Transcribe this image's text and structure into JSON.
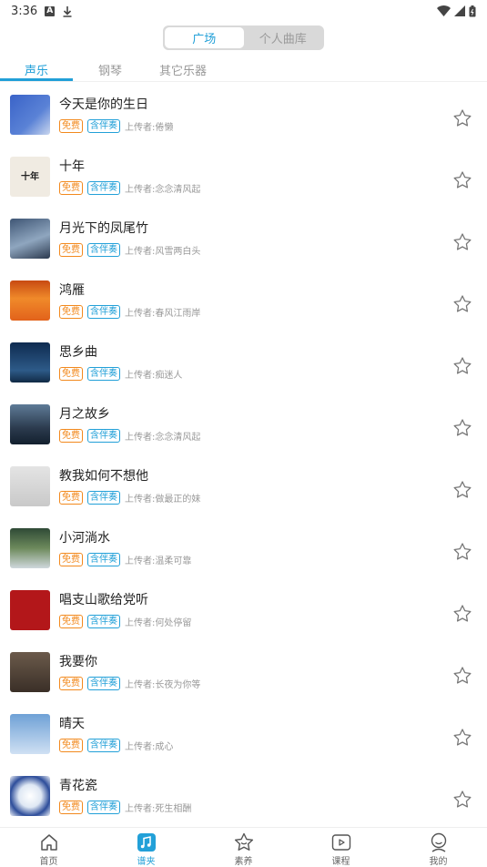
{
  "status_bar": {
    "time": "3:36",
    "icons": [
      "a-icon",
      "download-icon",
      "wifi-icon",
      "signal-icon",
      "battery-icon"
    ]
  },
  "segment": {
    "options": [
      "广场",
      "个人曲库"
    ],
    "selected": "广场"
  },
  "tabs": [
    {
      "label": "声乐",
      "active": true
    },
    {
      "label": "钢琴",
      "active": false
    },
    {
      "label": "其它乐器",
      "active": false
    }
  ],
  "tags": {
    "free": "免费",
    "accompaniment": "含伴奏"
  },
  "songs": [
    {
      "title": "今天是你的生日",
      "uploader": "上传者:倦懒",
      "thumb_text": ""
    },
    {
      "title": "十年",
      "uploader": "上传者:念念清风起",
      "thumb_text": "十年"
    },
    {
      "title": "月光下的凤尾竹",
      "uploader": "上传者:风雪两白头",
      "thumb_text": ""
    },
    {
      "title": "鸿雁",
      "uploader": "上传者:春风江雨岸",
      "thumb_text": ""
    },
    {
      "title": "思乡曲",
      "uploader": "上传者:痴迷人",
      "thumb_text": ""
    },
    {
      "title": "月之故乡",
      "uploader": "上传者:念念清风起",
      "thumb_text": ""
    },
    {
      "title": "教我如何不想他",
      "uploader": "上传者:做最正的妹",
      "thumb_text": ""
    },
    {
      "title": "小河淌水",
      "uploader": "上传者:温柔可靠",
      "thumb_text": ""
    },
    {
      "title": "唱支山歌给党听",
      "uploader": "上传者:何处停留",
      "thumb_text": ""
    },
    {
      "title": "我要你",
      "uploader": "上传者:长夜为你等",
      "thumb_text": ""
    },
    {
      "title": "晴天",
      "uploader": "上传者:成心",
      "thumb_text": ""
    },
    {
      "title": "青花瓷",
      "uploader": "上传者:死生相酬",
      "thumb_text": ""
    }
  ],
  "bottom_nav": [
    {
      "label": "首页",
      "icon": "home-icon",
      "active": false
    },
    {
      "label": "谱夹",
      "icon": "music-folder-icon",
      "active": true
    },
    {
      "label": "素养",
      "icon": "star-badge-icon",
      "active": false
    },
    {
      "label": "课程",
      "icon": "course-play-icon",
      "active": false
    },
    {
      "label": "我的",
      "icon": "profile-icon",
      "active": false
    }
  ],
  "colors": {
    "accent": "#22a0d8",
    "free_tag": "#f2891d",
    "text_secondary": "#999999"
  }
}
